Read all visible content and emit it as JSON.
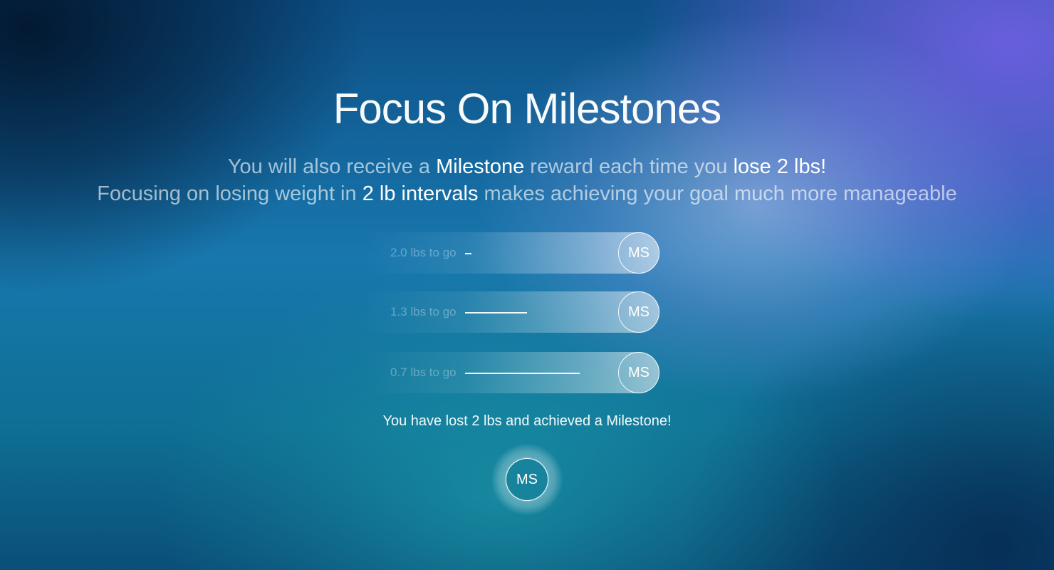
{
  "title": "Focus On Milestones",
  "subtitle_line1": {
    "part1": "You will also receive a ",
    "highlight1": "Milestone",
    "part2": " reward each time you ",
    "highlight2": "lose 2 lbs!"
  },
  "subtitle_line2": {
    "part1": "Focusing on losing weight in ",
    "highlight1": "2 lb intervals",
    "part2": " makes achieving your goal much more manageable"
  },
  "progress_tracks": [
    {
      "label": "2.0 lbs to go",
      "progress_fraction": 0.0,
      "badge": "MS"
    },
    {
      "label": "1.3 lbs to go",
      "progress_fraction": 0.35,
      "badge": "MS"
    },
    {
      "label": "0.7 lbs to go",
      "progress_fraction": 0.65,
      "badge": "MS"
    }
  ],
  "achievement": {
    "message": "You have lost 2 lbs and achieved a Milestone!",
    "badge": "MS"
  },
  "colors": {
    "accent_white": "#ffffff",
    "bg_blue": "#0d4f86",
    "bg_purple": "#6e5fe1",
    "bg_teal": "#1eaab4",
    "badge_fill": "#17839c"
  }
}
